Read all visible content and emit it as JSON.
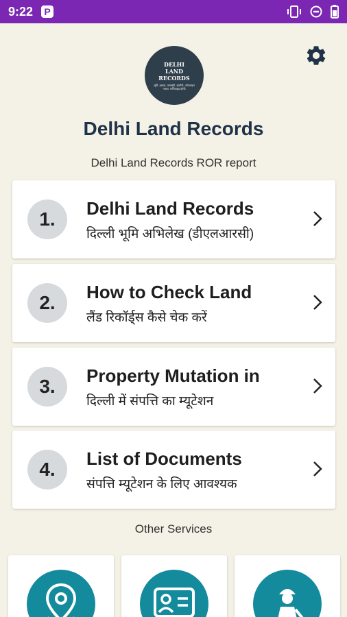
{
  "status_bar": {
    "time": "9:22",
    "app_icon_letter": "P",
    "icons": [
      "vibrate-icon",
      "do-not-disturb-icon",
      "battery-icon"
    ]
  },
  "header": {
    "logo": {
      "title_line1": "DELHI",
      "title_line2": "LAND",
      "title_line3": "RECORDS",
      "subtitle": "भूमि, ख़सरा, जमाबंदी, खतौनी, ऑनलाइन नक्शा, सर्टिफाइड कॉपी"
    },
    "title": "Delhi Land Records",
    "subtitle": "Delhi Land Records ROR report"
  },
  "menu": [
    {
      "number": "1.",
      "title": "Delhi Land Records",
      "subtitle": "दिल्ली भूमि अभिलेख (डीएलआरसी)"
    },
    {
      "number": "2.",
      "title": "How to Check Land",
      "subtitle": "लैंड रिकॉर्ड्स कैसे चेक करें"
    },
    {
      "number": "3.",
      "title": "Property Mutation in",
      "subtitle": "दिल्ली में संपत्ति का म्यूटेशन"
    },
    {
      "number": "4.",
      "title": "List of Documents",
      "subtitle": "संपत्ति म्यूटेशन के लिए आवश्यक"
    }
  ],
  "other_services": {
    "label": "Other Services",
    "items": [
      "location-pin-icon",
      "id-card-icon",
      "worker-icon"
    ]
  },
  "colors": {
    "status_bar": "#7b27b3",
    "background": "#f4f1e6",
    "accent_teal": "#148b9d",
    "title": "#1f3247"
  }
}
